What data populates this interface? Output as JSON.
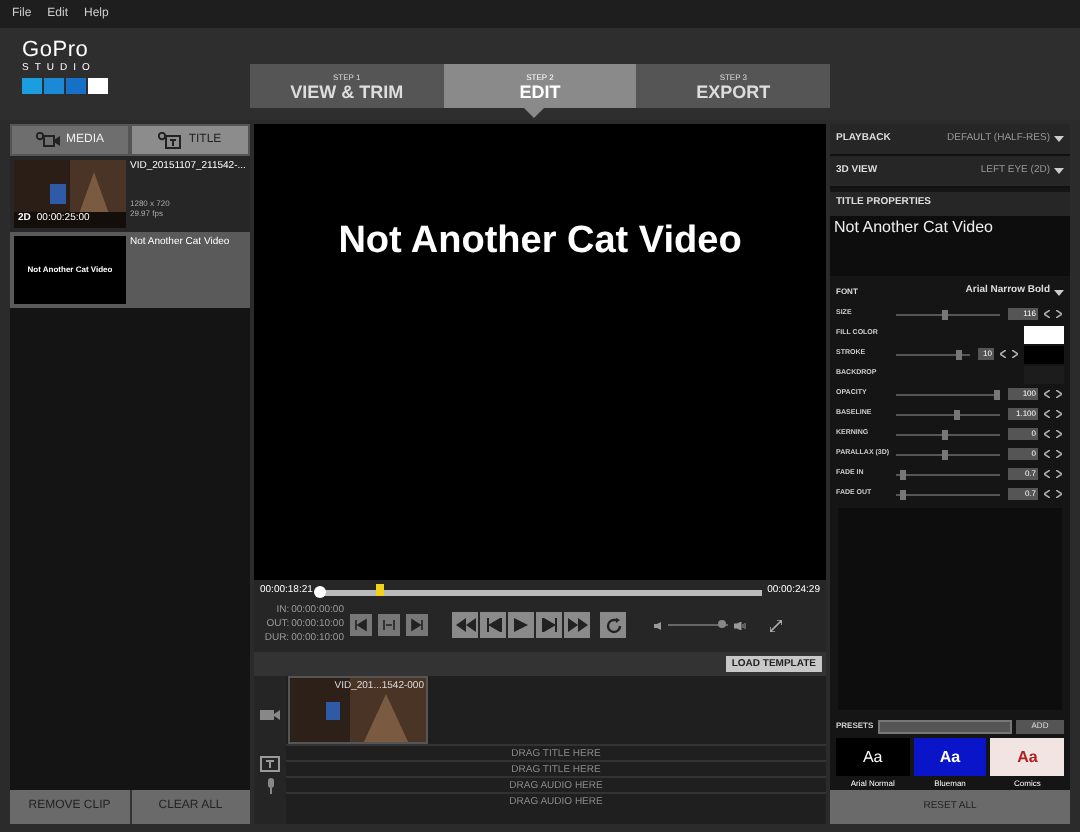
{
  "menu": [
    "File",
    "Edit",
    "Help"
  ],
  "logo": {
    "name": "GoPro",
    "sub": "STUDIO"
  },
  "steps": [
    {
      "step": "STEP 1",
      "label": "VIEW & TRIM",
      "selected": false
    },
    {
      "step": "STEP 2",
      "label": "EDIT",
      "selected": true
    },
    {
      "step": "STEP 3",
      "label": "EXPORT",
      "selected": false
    }
  ],
  "left_tabs": [
    {
      "label": "MEDIA",
      "selected": true
    },
    {
      "label": "TITLE",
      "selected": false
    }
  ],
  "clips": [
    {
      "kind": "video",
      "name": "VID_20151107_211542-...",
      "resolution": "1280 x 720",
      "fps": "29.97 fps",
      "badge": "2D",
      "duration": "00:00:25:00",
      "selected": false
    },
    {
      "kind": "title",
      "name": "Not Another Cat Video",
      "thumb_text": "Not Another Cat Video",
      "selected": true
    }
  ],
  "left_buttons": [
    "REMOVE CLIP",
    "CLEAR ALL"
  ],
  "preview": {
    "title": "Not Another Cat Video"
  },
  "transport": {
    "current": "00:00:18:21",
    "end": "00:00:24:29",
    "scrubber": {
      "level": 0.13
    },
    "in_out": [
      {
        "label": "IN:",
        "value": "00:00:00:00"
      },
      {
        "label": "OUT:",
        "value": "00:00:10:00"
      },
      {
        "label": "DUR:",
        "value": "00:00:10:00"
      }
    ]
  },
  "load_template": "LOAD TEMPLATE",
  "timeline": {
    "clip_name": "VID_201...1542-000",
    "hints": [
      "DRAG TITLE HERE",
      "DRAG TITLE HERE",
      "DRAG AUDIO HERE",
      "DRAG AUDIO HERE"
    ]
  },
  "playback": {
    "label": "PLAYBACK",
    "value": "DEFAULT (HALF-RES)"
  },
  "view_3d": {
    "label": "3D VIEW",
    "value": "LEFT EYE (2D)"
  },
  "title_properties": {
    "heading": "TITLE PROPERTIES",
    "text": "Not Another Cat Video",
    "font_label": "FONT",
    "font_value": "Arial Narrow Bold",
    "props": [
      {
        "kind": "slider",
        "label": "SIZE",
        "level": 0.45,
        "value": "116"
      },
      {
        "kind": "color",
        "label": "FILL COLOR",
        "color": "#ffffff"
      },
      {
        "kind": "slider_color",
        "label": "STROKE",
        "level": 0.8,
        "value": "10",
        "color": "#000000"
      },
      {
        "kind": "color",
        "label": "BACKDROP",
        "color": "#1c1c1c"
      },
      {
        "kind": "slider",
        "label": "OPACITY",
        "level": 0.95,
        "value": "100"
      },
      {
        "kind": "slider",
        "label": "BASELINE",
        "level": 0.55,
        "value": "1.100"
      },
      {
        "kind": "slider",
        "label": "KERNING",
        "level": 0.45,
        "value": "0"
      },
      {
        "kind": "slider",
        "label": "PARALLAX (3D)",
        "level": 0.45,
        "value": "0"
      },
      {
        "kind": "slider",
        "label": "FADE IN",
        "level": 0.03,
        "value": "0.7"
      },
      {
        "kind": "slider",
        "label": "FADE OUT",
        "level": 0.03,
        "value": "0.7"
      }
    ]
  },
  "presets": {
    "label": "PRESETS",
    "add": "ADD",
    "items": [
      {
        "kind": "plain",
        "sample": "Aa",
        "name": "Arial Normal",
        "color": "#000000"
      },
      {
        "kind": "bold",
        "sample": "Aa",
        "name": "Blueman",
        "color": "#0a14c8"
      },
      {
        "kind": "comic",
        "sample": "Aa",
        "name": "Comics",
        "color": "#f3e4e4"
      }
    ]
  },
  "reset": "RESET ALL"
}
